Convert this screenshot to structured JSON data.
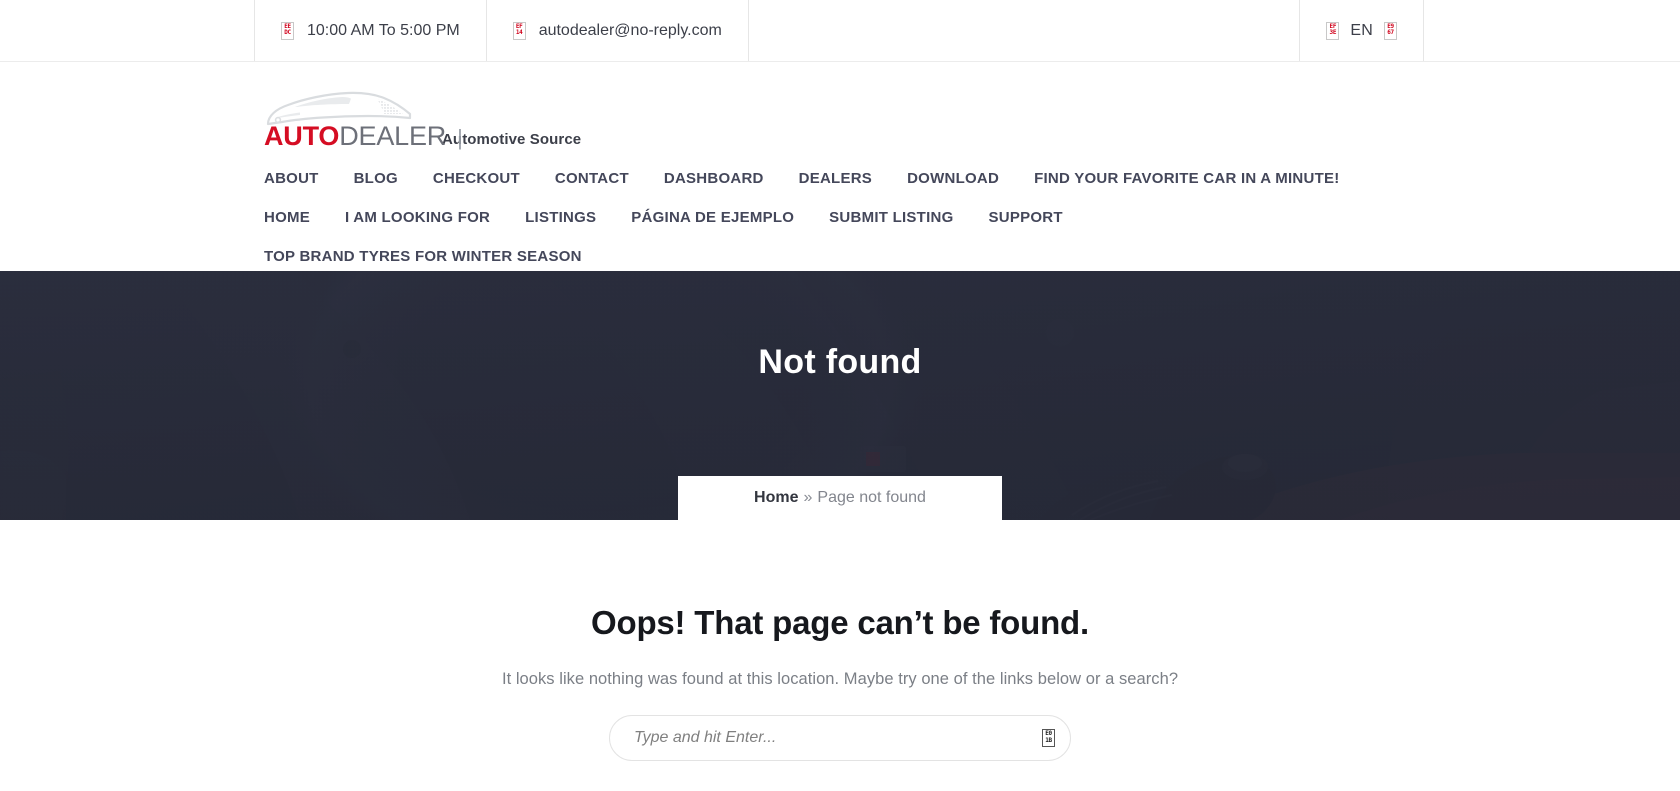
{
  "topbar": {
    "hours": "10:00 AM To 5:00 PM",
    "hours_icon": "clock-icon",
    "hours_icon_code": "EEDC",
    "email": "autodealer@no-reply.com",
    "email_icon": "envelope-icon",
    "email_icon_code": "EF14",
    "language": "EN",
    "globe_icon": "globe-icon",
    "globe_icon_code": "EF3E",
    "chevron_icon": "chevron-down-icon",
    "chevron_icon_code": "E967"
  },
  "brand": {
    "name_bold": "AUTO",
    "name_light": "DEALER",
    "separator": "|",
    "tagline": "Automotive Source",
    "color_accent": "#d50d23",
    "color_dark": "#6d7079"
  },
  "nav": {
    "items": [
      {
        "label": "ABOUT"
      },
      {
        "label": "BLOG"
      },
      {
        "label": "CHECKOUT"
      },
      {
        "label": "CONTACT"
      },
      {
        "label": "DASHBOARD"
      },
      {
        "label": "DEALERS"
      },
      {
        "label": "DOWNLOAD"
      },
      {
        "label": "FIND YOUR FAVORITE CAR IN A MINUTE!"
      },
      {
        "label": "HOME"
      },
      {
        "label": "I AM LOOKING FOR"
      },
      {
        "label": "LISTINGS"
      },
      {
        "label": "PÁGINA DE EJEMPLO"
      },
      {
        "label": "SUBMIT LISTING"
      },
      {
        "label": "SUPPORT"
      },
      {
        "label": "TOP BRAND TYRES FOR WINTER SEASON"
      }
    ]
  },
  "hero": {
    "title": "Not found",
    "background_color": "#2a2d3c",
    "breadcrumb": {
      "home": "Home",
      "separator": "»",
      "current": "Page not found"
    }
  },
  "main": {
    "error_title": "Oops! That page can’t be found.",
    "error_description": "It looks like nothing was found at this location. Maybe try one of the links below or a search?",
    "search": {
      "placeholder": "Type and hit Enter...",
      "value": "",
      "icon": "search-icon",
      "icon_code": "E01B"
    }
  }
}
